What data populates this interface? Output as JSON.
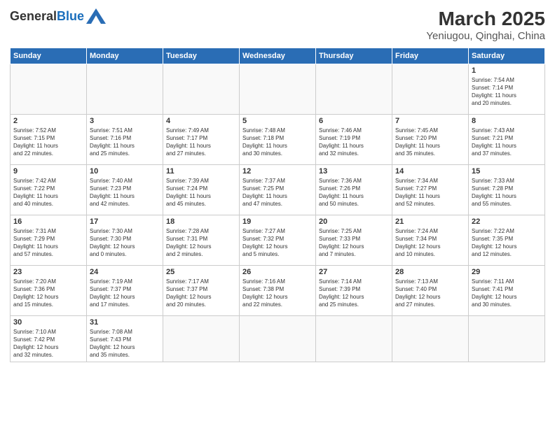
{
  "header": {
    "logo_general": "General",
    "logo_blue": "Blue",
    "title": "March 2025",
    "subtitle": "Yeniugou, Qinghai, China"
  },
  "days_of_week": [
    "Sunday",
    "Monday",
    "Tuesday",
    "Wednesday",
    "Thursday",
    "Friday",
    "Saturday"
  ],
  "weeks": [
    [
      {
        "day": "",
        "info": ""
      },
      {
        "day": "",
        "info": ""
      },
      {
        "day": "",
        "info": ""
      },
      {
        "day": "",
        "info": ""
      },
      {
        "day": "",
        "info": ""
      },
      {
        "day": "",
        "info": ""
      },
      {
        "day": "1",
        "info": "Sunrise: 7:54 AM\nSunset: 7:14 PM\nDaylight: 11 hours\nand 20 minutes."
      }
    ],
    [
      {
        "day": "2",
        "info": "Sunrise: 7:52 AM\nSunset: 7:15 PM\nDaylight: 11 hours\nand 22 minutes."
      },
      {
        "day": "3",
        "info": "Sunrise: 7:51 AM\nSunset: 7:16 PM\nDaylight: 11 hours\nand 25 minutes."
      },
      {
        "day": "4",
        "info": "Sunrise: 7:49 AM\nSunset: 7:17 PM\nDaylight: 11 hours\nand 27 minutes."
      },
      {
        "day": "5",
        "info": "Sunrise: 7:48 AM\nSunset: 7:18 PM\nDaylight: 11 hours\nand 30 minutes."
      },
      {
        "day": "6",
        "info": "Sunrise: 7:46 AM\nSunset: 7:19 PM\nDaylight: 11 hours\nand 32 minutes."
      },
      {
        "day": "7",
        "info": "Sunrise: 7:45 AM\nSunset: 7:20 PM\nDaylight: 11 hours\nand 35 minutes."
      },
      {
        "day": "8",
        "info": "Sunrise: 7:43 AM\nSunset: 7:21 PM\nDaylight: 11 hours\nand 37 minutes."
      }
    ],
    [
      {
        "day": "9",
        "info": "Sunrise: 7:42 AM\nSunset: 7:22 PM\nDaylight: 11 hours\nand 40 minutes."
      },
      {
        "day": "10",
        "info": "Sunrise: 7:40 AM\nSunset: 7:23 PM\nDaylight: 11 hours\nand 42 minutes."
      },
      {
        "day": "11",
        "info": "Sunrise: 7:39 AM\nSunset: 7:24 PM\nDaylight: 11 hours\nand 45 minutes."
      },
      {
        "day": "12",
        "info": "Sunrise: 7:37 AM\nSunset: 7:25 PM\nDaylight: 11 hours\nand 47 minutes."
      },
      {
        "day": "13",
        "info": "Sunrise: 7:36 AM\nSunset: 7:26 PM\nDaylight: 11 hours\nand 50 minutes."
      },
      {
        "day": "14",
        "info": "Sunrise: 7:34 AM\nSunset: 7:27 PM\nDaylight: 11 hours\nand 52 minutes."
      },
      {
        "day": "15",
        "info": "Sunrise: 7:33 AM\nSunset: 7:28 PM\nDaylight: 11 hours\nand 55 minutes."
      }
    ],
    [
      {
        "day": "16",
        "info": "Sunrise: 7:31 AM\nSunset: 7:29 PM\nDaylight: 11 hours\nand 57 minutes."
      },
      {
        "day": "17",
        "info": "Sunrise: 7:30 AM\nSunset: 7:30 PM\nDaylight: 12 hours\nand 0 minutes."
      },
      {
        "day": "18",
        "info": "Sunrise: 7:28 AM\nSunset: 7:31 PM\nDaylight: 12 hours\nand 2 minutes."
      },
      {
        "day": "19",
        "info": "Sunrise: 7:27 AM\nSunset: 7:32 PM\nDaylight: 12 hours\nand 5 minutes."
      },
      {
        "day": "20",
        "info": "Sunrise: 7:25 AM\nSunset: 7:33 PM\nDaylight: 12 hours\nand 7 minutes."
      },
      {
        "day": "21",
        "info": "Sunrise: 7:24 AM\nSunset: 7:34 PM\nDaylight: 12 hours\nand 10 minutes."
      },
      {
        "day": "22",
        "info": "Sunrise: 7:22 AM\nSunset: 7:35 PM\nDaylight: 12 hours\nand 12 minutes."
      }
    ],
    [
      {
        "day": "23",
        "info": "Sunrise: 7:20 AM\nSunset: 7:36 PM\nDaylight: 12 hours\nand 15 minutes."
      },
      {
        "day": "24",
        "info": "Sunrise: 7:19 AM\nSunset: 7:37 PM\nDaylight: 12 hours\nand 17 minutes."
      },
      {
        "day": "25",
        "info": "Sunrise: 7:17 AM\nSunset: 7:37 PM\nDaylight: 12 hours\nand 20 minutes."
      },
      {
        "day": "26",
        "info": "Sunrise: 7:16 AM\nSunset: 7:38 PM\nDaylight: 12 hours\nand 22 minutes."
      },
      {
        "day": "27",
        "info": "Sunrise: 7:14 AM\nSunset: 7:39 PM\nDaylight: 12 hours\nand 25 minutes."
      },
      {
        "day": "28",
        "info": "Sunrise: 7:13 AM\nSunset: 7:40 PM\nDaylight: 12 hours\nand 27 minutes."
      },
      {
        "day": "29",
        "info": "Sunrise: 7:11 AM\nSunset: 7:41 PM\nDaylight: 12 hours\nand 30 minutes."
      }
    ],
    [
      {
        "day": "30",
        "info": "Sunrise: 7:10 AM\nSunset: 7:42 PM\nDaylight: 12 hours\nand 32 minutes."
      },
      {
        "day": "31",
        "info": "Sunrise: 7:08 AM\nSunset: 7:43 PM\nDaylight: 12 hours\nand 35 minutes."
      },
      {
        "day": "",
        "info": ""
      },
      {
        "day": "",
        "info": ""
      },
      {
        "day": "",
        "info": ""
      },
      {
        "day": "",
        "info": ""
      },
      {
        "day": "",
        "info": ""
      }
    ]
  ]
}
